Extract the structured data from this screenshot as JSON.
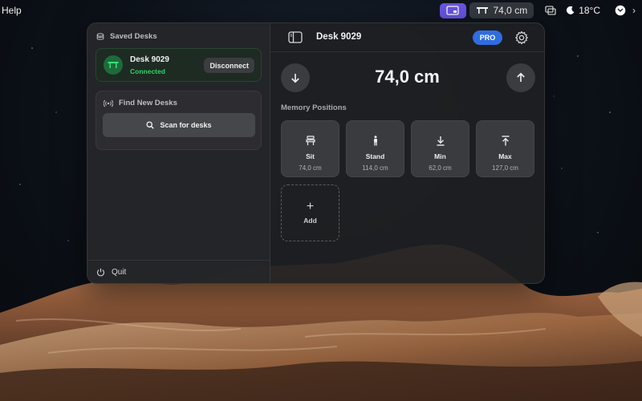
{
  "menubar": {
    "help_label": "Help",
    "desk_height": "74,0 cm",
    "weather_temp": "18°C",
    "accent_color": "#6a55e6"
  },
  "left_panel": {
    "saved_desks_title": "Saved Desks",
    "saved_desk": {
      "name": "Desk 9029",
      "status": "Connected",
      "status_color": "#2fd36a",
      "disconnect_label": "Disconnect"
    },
    "find_new_title": "Find New Desks",
    "scan_label": "Scan for desks",
    "quit_label": "Quit"
  },
  "main": {
    "desk_title": "Desk 9029",
    "pro_badge": "PRO",
    "current_height": "74,0 cm",
    "memory_title": "Memory Positions",
    "memory_positions": [
      {
        "name": "Sit",
        "value": "74,0 cm",
        "icon": "chair-icon"
      },
      {
        "name": "Stand",
        "value": "114,0 cm",
        "icon": "person-standing-icon"
      },
      {
        "name": "Min",
        "value": "62,0 cm",
        "icon": "arrow-down-to-line-icon"
      },
      {
        "name": "Max",
        "value": "127,0 cm",
        "icon": "arrow-up-to-line-icon"
      }
    ],
    "add_label": "Add"
  }
}
